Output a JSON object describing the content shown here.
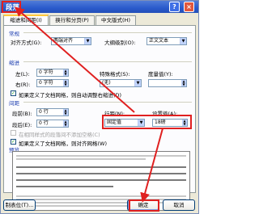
{
  "window": {
    "title": "段落",
    "help_label": "?",
    "close_label": "×"
  },
  "tabs": [
    {
      "label": "缩进和间距(I)",
      "active": true
    },
    {
      "label": "换行和分页(P)",
      "active": false
    },
    {
      "label": "中文版式(H)",
      "active": false
    }
  ],
  "general": {
    "section": "常规",
    "alignment_label": "对齐方式(G):",
    "alignment_value": "两端对齐",
    "outline_label": "大纲级别(O):",
    "outline_value": "正文文本"
  },
  "indent": {
    "section": "缩进",
    "left_label": "左(L):",
    "left_value": "0 字符",
    "right_label": "右(R):",
    "right_value": "0 字符",
    "special_label": "特殊格式(S):",
    "special_value": "(无)",
    "by_label": "度量值(Y):",
    "by_value": "",
    "grid_check": "如果定义了文档网格，则自动调整右缩进(D)"
  },
  "spacing": {
    "section": "间距",
    "before_label": "段前(B):",
    "before_value": "0 行",
    "after_label": "段后(E):",
    "after_value": "0 行",
    "line_label": "行距(N):",
    "line_value": "固定值",
    "at_label": "设置值(A):",
    "at_value": "18磅",
    "same_style_check": "在相同样式的段落间不添加空格(C)",
    "snap_check": "如果定义了文档网格，则对齐网格(W)"
  },
  "preview": {
    "section": "预览"
  },
  "buttons": {
    "tabs": "制表位(T)...",
    "ok": "确定",
    "cancel": "取消"
  }
}
